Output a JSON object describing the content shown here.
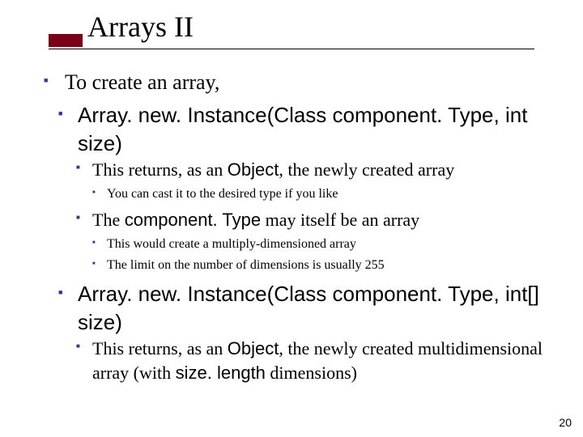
{
  "title": "Arrays II",
  "bullets": {
    "l1a": "To create an array,",
    "l2a_pre": "Array. new. Instance(Class component. Type, int size)",
    "l3a_pre": "This returns, as an ",
    "l3a_code": "Object",
    "l3a_post": ", the newly created array",
    "l4a": "You can cast it to the desired type if you like",
    "l3b_pre": "The ",
    "l3b_code": "component. Type",
    "l3b_post": " may itself be an array",
    "l4b": "This would create a multiply-dimensioned array",
    "l4c": "The limit on the number of dimensions is usually 255",
    "l2b_pre": "Array. new. Instance(Class component. Type, int[] size)",
    "l3c_pre": "This returns, as an ",
    "l3c_code": "Object",
    "l3c_mid": ", the newly created multidimensional array (with ",
    "l3c_code2": "size. length",
    "l3c_post": " dimensions)"
  },
  "page_number": "20"
}
